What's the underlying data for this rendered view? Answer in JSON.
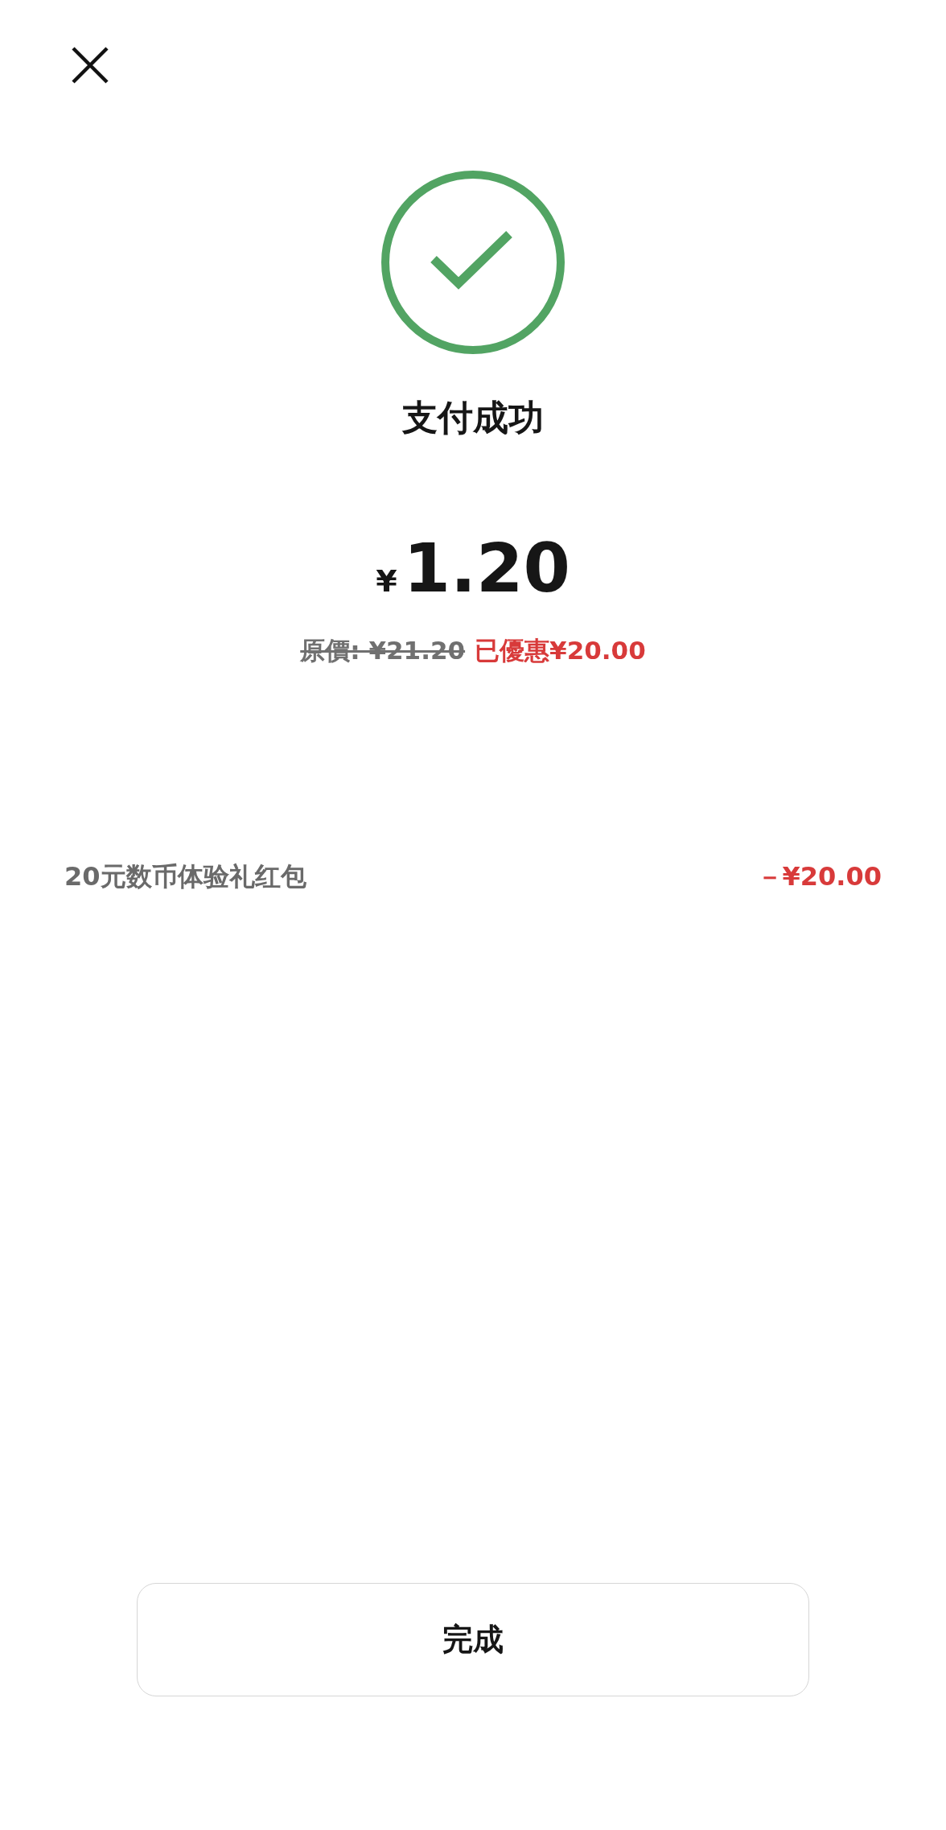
{
  "status": {
    "title": "支付成功",
    "success": true
  },
  "amount": {
    "currency": "¥",
    "value": "1.20"
  },
  "price_line": {
    "original": "原價: ¥21.20",
    "discount": "已優惠¥20.00"
  },
  "discount_items": [
    {
      "label": "20元数币体验礼红包",
      "amount": "－¥20.00"
    }
  ],
  "buttons": [
    {
      "label": "完成"
    }
  ]
}
